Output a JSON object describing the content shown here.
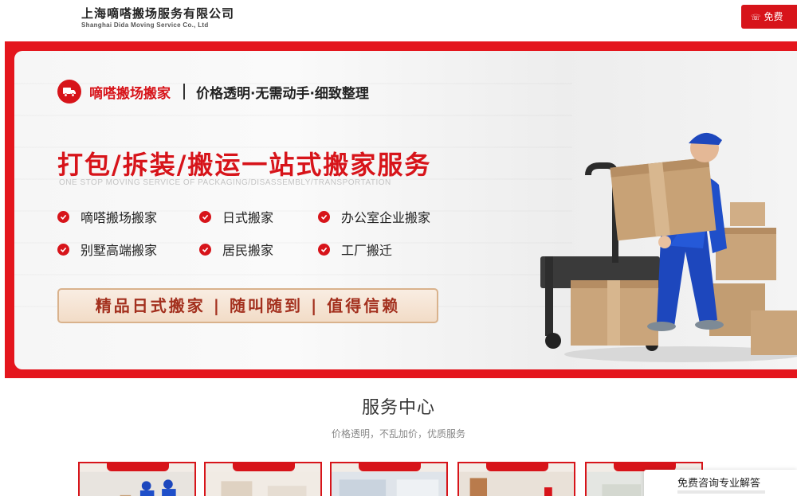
{
  "header": {
    "company_cn": "上海嘀嗒搬场服务有限公司",
    "company_en": "Shanghai Dida Moving Service Co., Ltd",
    "cta_label": "免费"
  },
  "banner": {
    "brand_name": "嘀嗒搬场搬家",
    "slogan": "价格透明·无需动手·细致整理",
    "title": "打包/拆装/搬运一站式搬家服务",
    "subtitle_en": "ONE STOP MOVING SERVICE OF PACKAGING/DISASSEMBLY/TRANSPORTATION",
    "features": [
      "嘀嗒搬场搬家",
      "日式搬家",
      "办公室企业搬家",
      "别墅高端搬家",
      "居民搬家",
      "工厂搬迁"
    ],
    "promo": "精品日式搬家 | 随叫随到 | 值得信赖"
  },
  "services": {
    "title": "服务中心",
    "subtitle": "价格透明，不乱加价，优质服务"
  },
  "consult": {
    "title": "免费咨询专业解答"
  },
  "colors": {
    "brand_red": "#d7141a",
    "promo_text": "#a3301e",
    "promo_border": "#d9b28c"
  }
}
